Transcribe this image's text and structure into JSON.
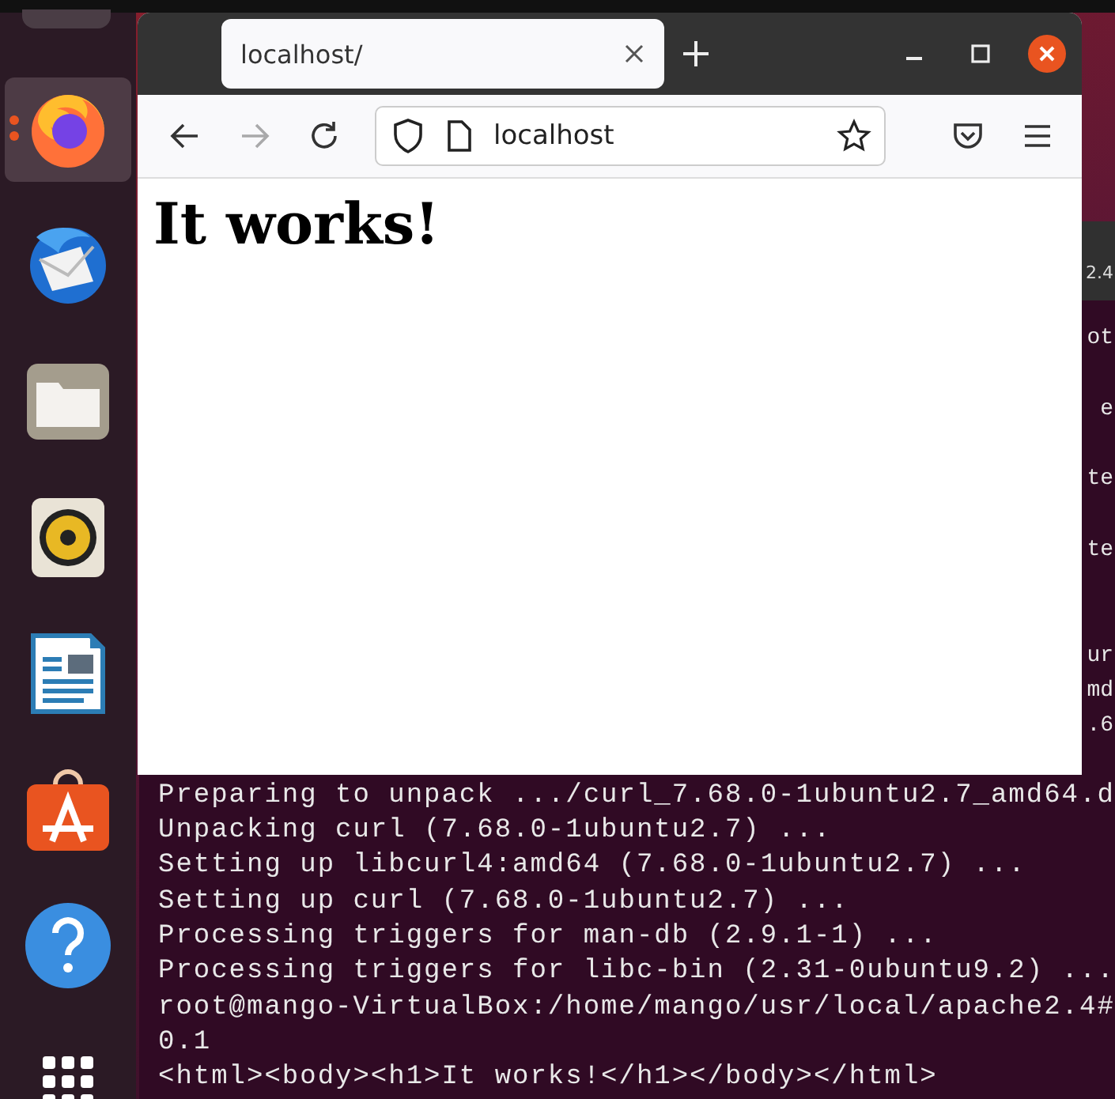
{
  "dock": {
    "items": [
      {
        "kind": "browser",
        "selected": true,
        "running": true
      },
      {
        "kind": "mail",
        "selected": false,
        "running": false
      },
      {
        "kind": "files",
        "selected": false,
        "running": false
      },
      {
        "kind": "music",
        "selected": false,
        "running": false
      },
      {
        "kind": "writer",
        "selected": false,
        "running": false
      },
      {
        "kind": "store",
        "selected": false,
        "running": false
      },
      {
        "kind": "help",
        "selected": false,
        "running": false
      },
      {
        "kind": "apps",
        "selected": false,
        "running": false
      }
    ]
  },
  "terminal": {
    "title": "2.4",
    "lines": [
      {
        "kind": "tail",
        "text": "ot"
      },
      {
        "kind": "blank"
      },
      {
        "kind": "tail",
        "text": "e"
      },
      {
        "kind": "blank"
      },
      {
        "kind": "tail",
        "text": "te"
      },
      {
        "kind": "blank"
      },
      {
        "kind": "tail",
        "text": "te"
      },
      {
        "kind": "blank"
      },
      {
        "kind": "blank"
      },
      {
        "kind": "tail",
        "text": "ur"
      },
      {
        "kind": "tail",
        "text": "md"
      },
      {
        "kind": "tail",
        "text": ".6"
      },
      {
        "kind": "blank"
      },
      {
        "kind": "text",
        "text": "Preparing to unpack .../curl_7.68.0-1ubuntu2.7_amd64.d"
      },
      {
        "kind": "text",
        "text": "Unpacking curl (7.68.0-1ubuntu2.7) ..."
      },
      {
        "kind": "text",
        "text": "Setting up libcurl4:amd64 (7.68.0-1ubuntu2.7) ..."
      },
      {
        "kind": "text",
        "text": "Setting up curl (7.68.0-1ubuntu2.7) ..."
      },
      {
        "kind": "text",
        "text": "Processing triggers for man-db (2.9.1-1) ..."
      },
      {
        "kind": "text",
        "text": "Processing triggers for libc-bin (2.31-0ubuntu9.2) ..."
      },
      {
        "kind": "text",
        "text": "root@mango-VirtualBox:/home/mango/usr/local/apache2.4#"
      },
      {
        "kind": "text",
        "text": "0.1"
      },
      {
        "kind": "text",
        "text": "<html><body><h1>It works!</h1></body></html>"
      }
    ]
  },
  "browser": {
    "tabs": [
      {
        "title": "localhost/",
        "selected": true
      }
    ],
    "back": {
      "disabled": false
    },
    "forward": {
      "disabled": true
    },
    "url": "localhost",
    "heading": "It works!"
  }
}
